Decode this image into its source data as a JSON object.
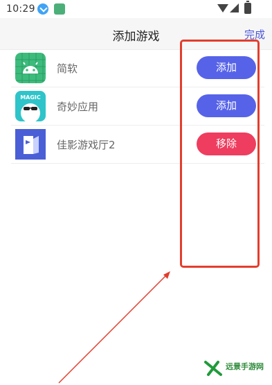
{
  "status_bar": {
    "time": "10:29"
  },
  "header": {
    "title": "添加游戏",
    "done_label": "完成"
  },
  "apps": [
    {
      "name": "简软",
      "action": "添加",
      "icon": "android-icon"
    },
    {
      "name": "奇妙应用",
      "action": "添加",
      "icon": "magic-icon",
      "icon_text": "MAGIC"
    },
    {
      "name": "佳影游戏厅2",
      "action": "移除",
      "icon": "jiaying-icon"
    }
  ],
  "colors": {
    "add": "#5663e8",
    "remove": "#ee3d5e",
    "highlight": "#e33d2d",
    "done": "#4b57d9"
  },
  "watermark": {
    "text": "远景手游网"
  }
}
